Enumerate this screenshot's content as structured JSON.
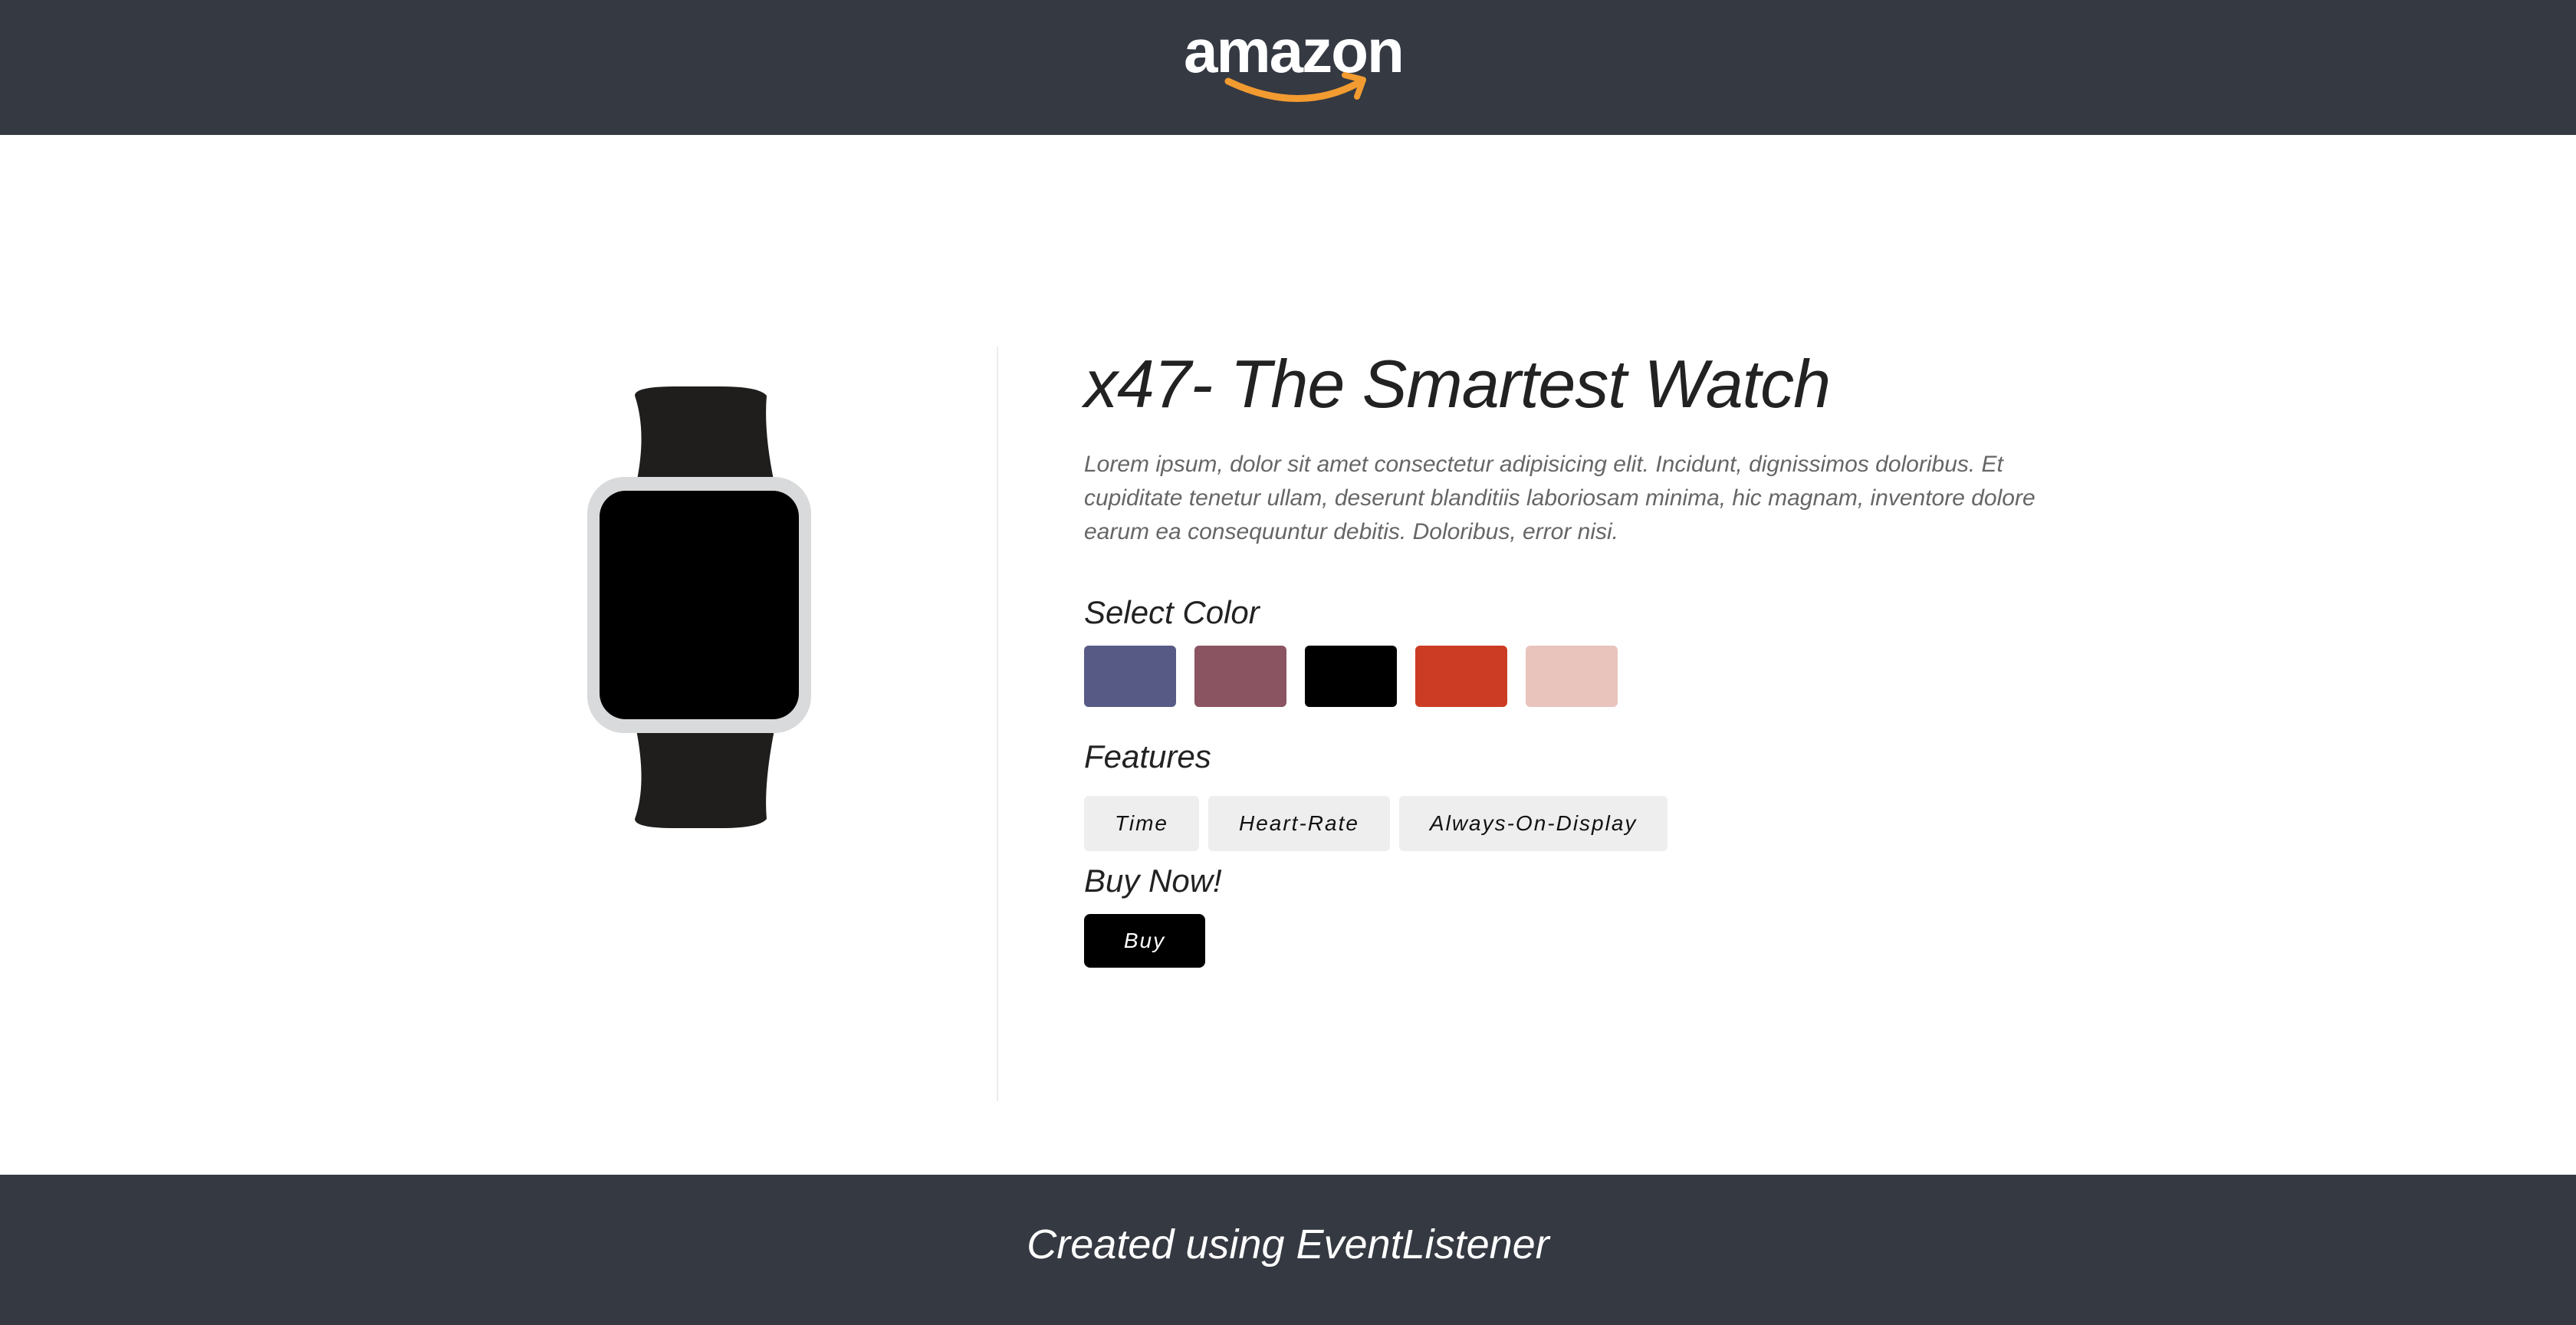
{
  "header": {
    "logo_text": "amazon",
    "background": "#353942"
  },
  "product": {
    "title": "x47- The Smartest Watch",
    "description": "Lorem ipsum, dolor sit amet consectetur adipisicing elit. Incidunt, dignissimos doloribus. Et cupiditate tenetur ullam, deserunt blanditiis laboriosam minima, hic magnam, inventore dolore earum ea consequuntur debitis. Doloribus, error nisi.",
    "image_icon": "smartwatch-icon"
  },
  "color_section": {
    "label": "Select Color",
    "swatches": [
      "#575a85",
      "#8a5461",
      "#000000",
      "#cc3c24",
      "#e8c4bd"
    ]
  },
  "features_section": {
    "label": "Features",
    "items": [
      "Time",
      "Heart-Rate",
      "Always-On-Display"
    ]
  },
  "buy_section": {
    "label": "Buy Now!",
    "button_label": "Buy"
  },
  "footer": {
    "text": "Created using EventListener"
  }
}
